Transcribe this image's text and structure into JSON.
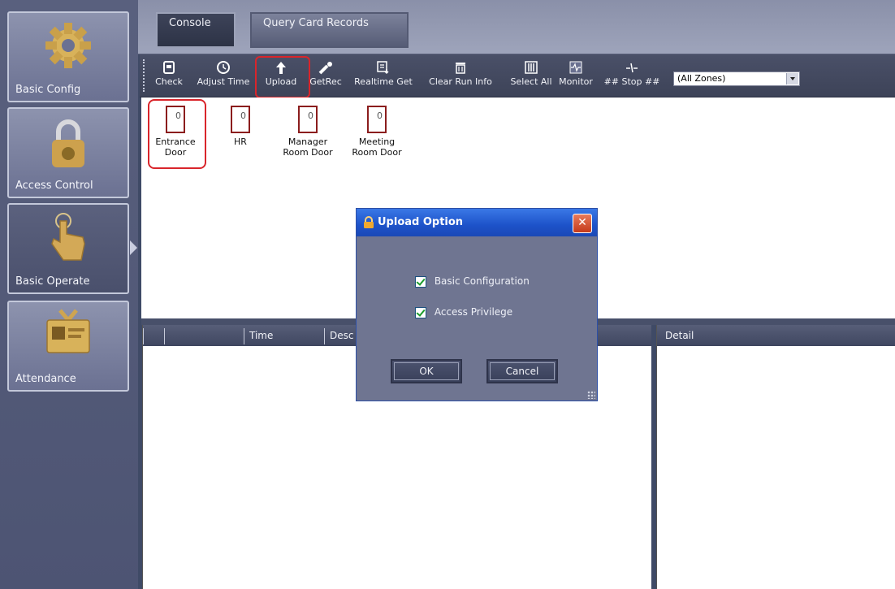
{
  "sidebar": {
    "items": [
      {
        "label": "Basic Config",
        "icon": "gear-icon"
      },
      {
        "label": "Access Control",
        "icon": "padlock-icon"
      },
      {
        "label": "Basic Operate",
        "icon": "pointing-hand-icon"
      },
      {
        "label": "Attendance",
        "icon": "id-card-icon"
      }
    ]
  },
  "topbar": {
    "tabs": [
      {
        "label": "Console"
      },
      {
        "label": "Query Card Records"
      }
    ]
  },
  "toolbar": {
    "buttons": [
      {
        "label": "Check",
        "icon": "check-icon"
      },
      {
        "label": "Adjust Time",
        "icon": "clock-icon"
      },
      {
        "label": "Upload",
        "icon": "upload-arrow-icon"
      },
      {
        "label": "GetRec",
        "icon": "get-record-icon"
      },
      {
        "label": "Realtime Get",
        "icon": "realtime-get-icon"
      },
      {
        "label": "Clear Run Info",
        "icon": "clear-icon"
      },
      {
        "label": "Select All",
        "icon": "select-all-icon"
      },
      {
        "label": "Monitor",
        "icon": "monitor-icon"
      },
      {
        "label": "## Stop ##",
        "icon": "stop-icon"
      }
    ],
    "zone_select": {
      "value": "(All Zones)"
    }
  },
  "doors": [
    {
      "count": "0",
      "name_line1": "Entrance",
      "name_line2": "Door"
    },
    {
      "count": "0",
      "name_line1": "HR",
      "name_line2": ""
    },
    {
      "count": "0",
      "name_line1": "Manager",
      "name_line2": "Room Door"
    },
    {
      "count": "0",
      "name_line1": "Meeting",
      "name_line2": "Room Door"
    }
  ],
  "log_table": {
    "columns": [
      "",
      "",
      "Time",
      "Desc"
    ]
  },
  "detail_table": {
    "columns": [
      "Detail"
    ]
  },
  "dialog": {
    "title": "Upload Option",
    "close": "✕",
    "options": [
      {
        "label": "Basic Configuration",
        "checked": true
      },
      {
        "label": "Access Privilege",
        "checked": true
      }
    ],
    "ok_label": "OK",
    "cancel_label": "Cancel"
  },
  "colors": {
    "highlight": "#d9252b",
    "titlebar": "#1d52c9"
  }
}
